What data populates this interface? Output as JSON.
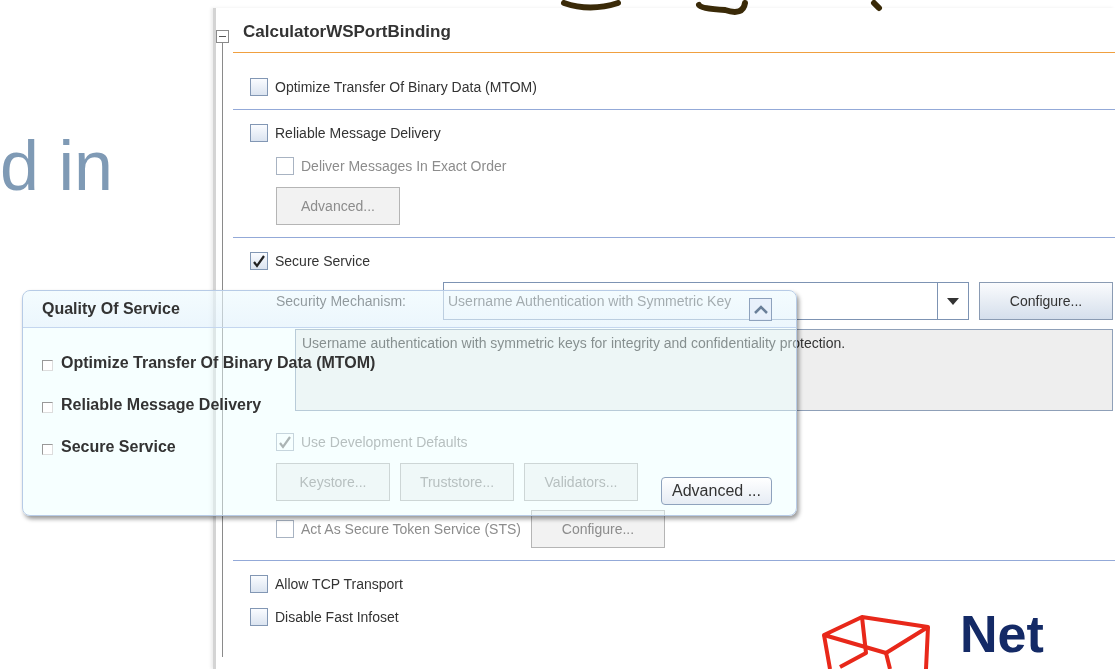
{
  "slide": {
    "heading_fragment": "d in",
    "logo_text": "Net"
  },
  "panel": {
    "title": "CalculatorWSPortBinding",
    "expanded": true,
    "sections": [
      {
        "items": [
          {
            "kind": "checkbox",
            "label": "Optimize Transfer Of Binary Data (MTOM)",
            "checked": false,
            "disabled": false
          }
        ]
      },
      {
        "items": [
          {
            "kind": "checkbox",
            "label": "Reliable Message Delivery",
            "checked": false,
            "disabled": false,
            "children": [
              {
                "kind": "checkbox",
                "label": "Deliver Messages In Exact Order",
                "checked": false,
                "disabled": true
              },
              {
                "kind": "button",
                "label": "Advanced...",
                "disabled": true
              }
            ]
          }
        ]
      },
      {
        "items": [
          {
            "kind": "checkbox",
            "label": "Secure Service",
            "checked": true,
            "disabled": false,
            "children": [
              {
                "kind": "combo",
                "label": "Security Mechanism:",
                "value": "Username Authentication with Symmetric Key",
                "button": {
                  "label": "Configure...",
                  "disabled": false
                }
              },
              {
                "kind": "description",
                "text": "Username authentication with symmetric keys for integrity and confidentiality protection."
              },
              {
                "kind": "checkbox",
                "label": "Use Development Defaults",
                "checked": true,
                "disabled": true
              },
              {
                "kind": "buttons",
                "buttons": [
                  {
                    "label": "Keystore...",
                    "disabled": true
                  },
                  {
                    "label": "Truststore...",
                    "disabled": true
                  },
                  {
                    "label": "Validators...",
                    "disabled": true
                  }
                ]
              },
              {
                "kind": "checkbox",
                "label": "Act As Secure Token Service (STS)",
                "checked": false,
                "disabled": true,
                "button": {
                  "label": "Configure...",
                  "disabled": true
                }
              }
            ]
          }
        ]
      },
      {
        "items": [
          {
            "kind": "checkbox",
            "label": "Allow TCP Transport",
            "checked": false,
            "disabled": false
          },
          {
            "kind": "checkbox",
            "label": "Disable Fast Infoset",
            "checked": false,
            "disabled": false
          }
        ]
      }
    ]
  },
  "popup": {
    "title": "Quality Of Service",
    "options": [
      {
        "label": "Optimize Transfer Of Binary Data (MTOM)",
        "checked": false
      },
      {
        "label": "Reliable Message Delivery",
        "checked": false
      },
      {
        "label": "Secure Service",
        "checked": false
      }
    ],
    "button": "Advanced ..."
  }
}
